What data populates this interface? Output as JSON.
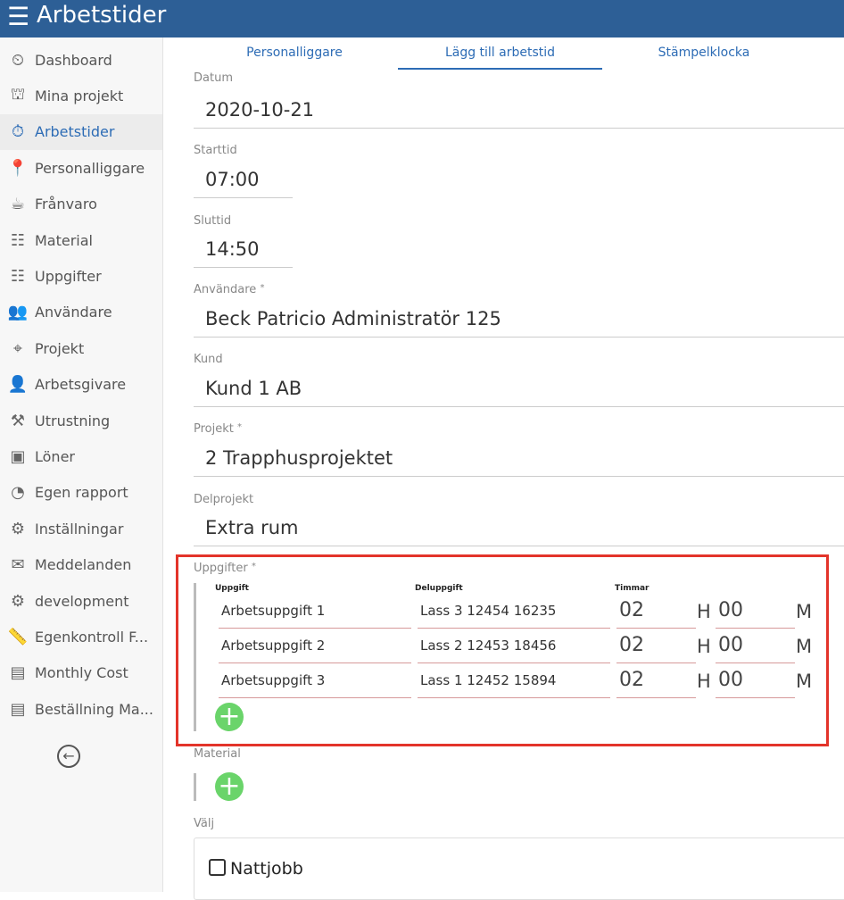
{
  "header": {
    "title": "Arbetstider",
    "menu_icon": "☰"
  },
  "sidebar": {
    "items": [
      {
        "label": "Dashboard",
        "icon": "⏲"
      },
      {
        "label": "Mina projekt",
        "icon": "⛫"
      },
      {
        "label": "Arbetstider",
        "icon": "⏱",
        "active": true
      },
      {
        "label": "Personalliggare",
        "icon": "📍"
      },
      {
        "label": "Frånvaro",
        "icon": "☕"
      },
      {
        "label": "Material",
        "icon": "☷"
      },
      {
        "label": "Uppgifter",
        "icon": "☷"
      },
      {
        "label": "Användare",
        "icon": "👥"
      },
      {
        "label": "Projekt",
        "icon": "⌖"
      },
      {
        "label": "Arbetsgivare",
        "icon": "👤"
      },
      {
        "label": "Utrustning",
        "icon": "⚒"
      },
      {
        "label": "Löner",
        "icon": "▣"
      },
      {
        "label": "Egen rapport",
        "icon": "◔"
      },
      {
        "label": "Inställningar",
        "icon": "⚙"
      },
      {
        "label": "Meddelanden",
        "icon": "✉"
      },
      {
        "label": "development",
        "icon": "⚙"
      },
      {
        "label": "Egenkontroll F...",
        "icon": "📏"
      },
      {
        "label": "Monthly Cost",
        "icon": "▤"
      },
      {
        "label": "Beställning Ma...",
        "icon": "▤"
      }
    ],
    "back_icon": "←"
  },
  "tabs": [
    "Personalliggare",
    "Lägg till arbetstid",
    "Stämpelklocka"
  ],
  "form": {
    "datum": {
      "label": "Datum",
      "value": "2020-10-21"
    },
    "starttid": {
      "label": "Starttid",
      "value": "07:00"
    },
    "sluttid": {
      "label": "Sluttid",
      "value": "14:50"
    },
    "anvandare": {
      "label": "Användare",
      "req": "*",
      "value": "Beck Patricio Administratör 125"
    },
    "kund": {
      "label": "Kund",
      "value": "Kund 1 AB"
    },
    "projekt": {
      "label": "Projekt",
      "req": "*",
      "value": "2 Trapphusprojektet"
    },
    "delprojekt": {
      "label": "Delprojekt",
      "value": "Extra rum"
    }
  },
  "uppgifter": {
    "label": "Uppgifter",
    "req": "*",
    "columns": [
      "Uppgift",
      "Deluppgift",
      "Timmar"
    ],
    "h": "H",
    "m": "M",
    "rows": [
      {
        "uppgift": "Arbetsuppgift 1",
        "deluppgift": "Lass 3 12454 16235",
        "hours": "02",
        "minutes": "00"
      },
      {
        "uppgift": "Arbetsuppgift 2",
        "deluppgift": "Lass 2 12453 18456",
        "hours": "02",
        "minutes": "00"
      },
      {
        "uppgift": "Arbetsuppgift 3",
        "deluppgift": "Lass 1 12452 15894",
        "hours": "02",
        "minutes": "00"
      }
    ]
  },
  "material": {
    "label": "Material"
  },
  "valj": {
    "label": "Välj",
    "checkbox_label": "Nattjobb",
    "checked": false
  },
  "plus": "+"
}
